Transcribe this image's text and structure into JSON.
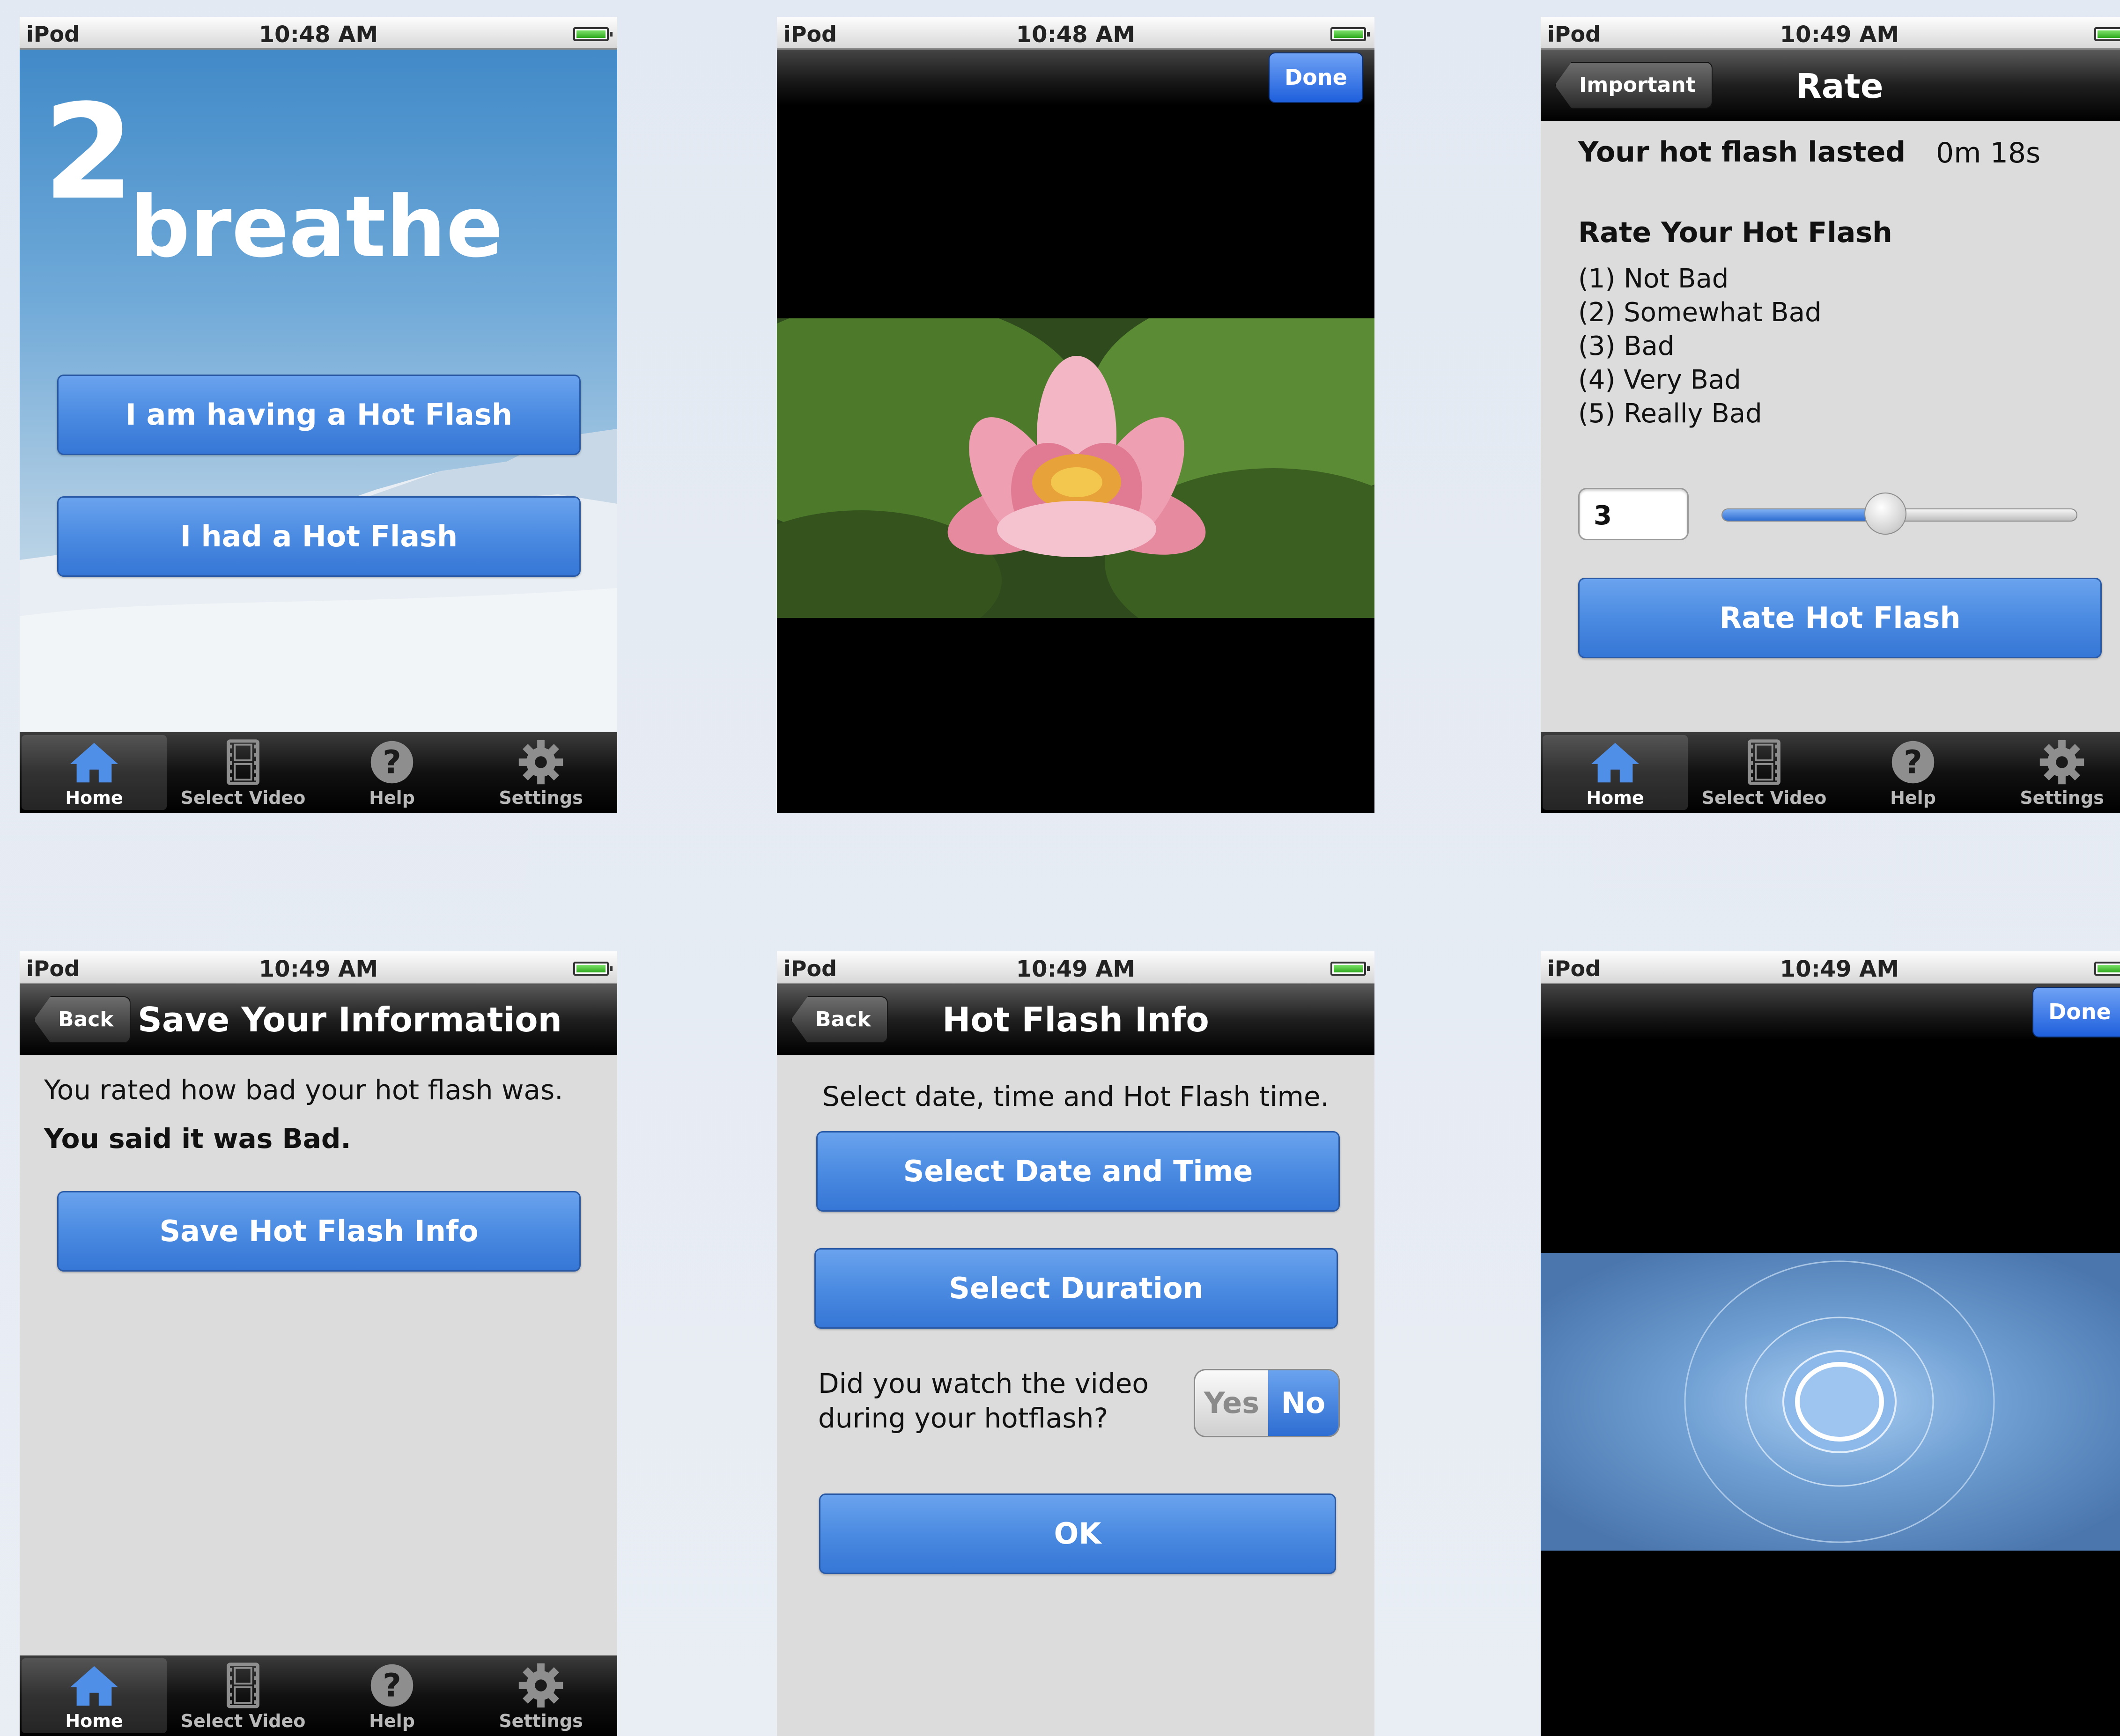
{
  "status": {
    "carrier": "iPod"
  },
  "tabs": [
    "Home",
    "Select Video",
    "Help",
    "Settings"
  ],
  "screens": {
    "home": {
      "time": "10:48 AM",
      "logo_number": "2",
      "logo_word": "breathe",
      "btn_having": "I am having a Hot Flash",
      "btn_had": "I had a Hot Flash"
    },
    "video1": {
      "time": "10:48 AM",
      "done": "Done"
    },
    "rate": {
      "time": "10:49 AM",
      "back": "Important",
      "title": "Rate",
      "lasted_label": "Your hot flash lasted",
      "lasted_value": "0m 18s",
      "heading": "Rate Your Hot Flash",
      "options": [
        "(1) Not Bad",
        "(2) Somewhat Bad",
        "(3) Bad",
        "(4) Very Bad",
        "(5) Really Bad"
      ],
      "rating_value": "3",
      "slider_fraction": 0.46,
      "button": "Rate Hot Flash"
    },
    "save": {
      "time": "10:49 AM",
      "back": "Back",
      "title": "Save Your Information",
      "line1": "You rated how bad your hot flash was.",
      "line2_prefix": "You said it was ",
      "line2_value": "Bad.",
      "button": "Save Hot Flash Info"
    },
    "info": {
      "time": "10:49 AM",
      "back": "Back",
      "title": "Hot Flash Info",
      "instruction": "Select date, time and Hot Flash time.",
      "btn_date": "Select Date and Time",
      "btn_duration": "Select Duration",
      "question_line1": "Did you watch the video",
      "question_line2": "during your hotflash?",
      "toggle_yes": "Yes",
      "toggle_no": "No",
      "ok": "OK"
    },
    "video2": {
      "time": "10:49 AM",
      "done": "Done"
    }
  },
  "colors": {
    "button_blue": "#4b8be1",
    "nav_black": "#000000",
    "screen_gray": "#dcdcdc"
  }
}
